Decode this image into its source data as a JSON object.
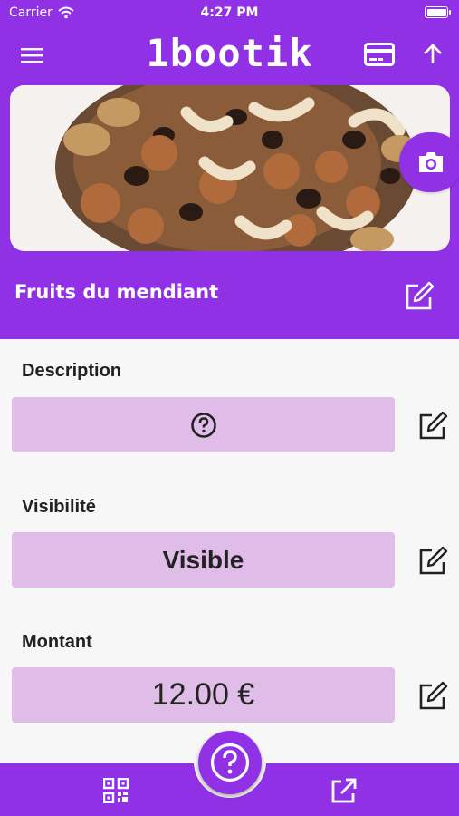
{
  "status_bar": {
    "carrier": "Carrier",
    "time": "4:27 PM"
  },
  "app_bar": {
    "title": "1bootik",
    "left_icon": "menu-icon",
    "right_icons": [
      "credit-card-icon",
      "arrow-up-icon"
    ]
  },
  "product": {
    "name": "Fruits du mendiant",
    "image": "mixed-nuts-photo"
  },
  "fields": {
    "description": {
      "label": "Description",
      "value_icon": "help-circle-icon"
    },
    "visibility": {
      "label": "Visibilité",
      "value": "Visible"
    },
    "amount": {
      "label": "Montant",
      "value": "12.00 €"
    }
  },
  "bottom_bar": {
    "left_icon": "qr-code-icon",
    "center_icon": "help-circle-icon",
    "right_icon": "open-external-icon"
  },
  "colors": {
    "primary": "#9131e6",
    "field_background": "#e0bce8",
    "page_background": "#f7f7f7"
  }
}
